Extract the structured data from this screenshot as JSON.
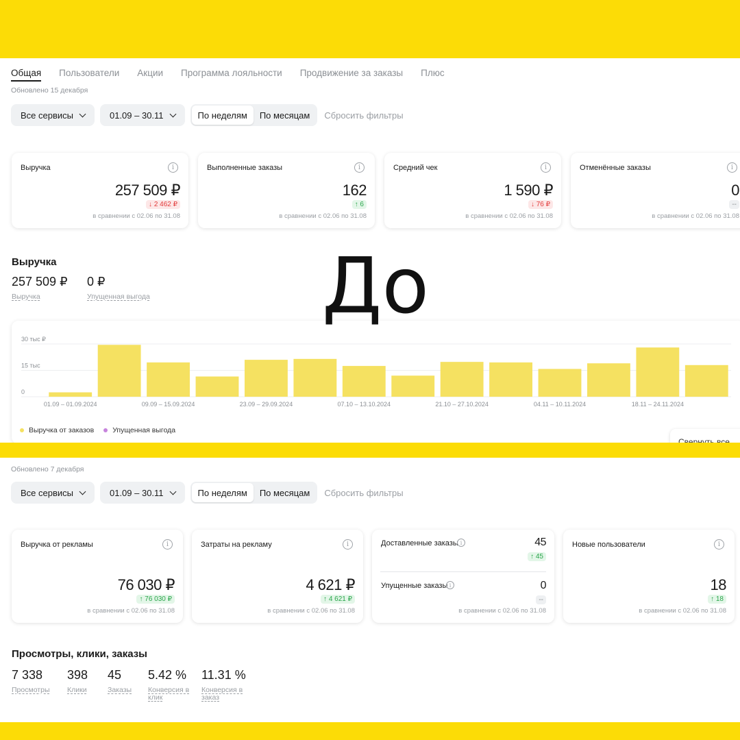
{
  "colors": {
    "brand_yellow": "#fcdc06",
    "bar_yellow": "#f5e161",
    "lost_purple": "#c784dd",
    "up_green": "#2aa54b",
    "down_red": "#e23b3b"
  },
  "overlay_label": "До",
  "top": {
    "tabs": [
      "Общая",
      "Пользователи",
      "Акции",
      "Программа лояльности",
      "Продвижение за заказы",
      "Плюс"
    ],
    "updated": "Обновлено 15 декабря",
    "filters": {
      "services": "Все сервисы",
      "period": "01.09 – 30.11",
      "by_week": "По неделям",
      "by_month": "По месяцам",
      "reset": "Сбросить фильтры"
    },
    "cards": [
      {
        "title": "Выручка",
        "value": "257 509 ₽",
        "delta": "↓ 2 462 ₽",
        "trend": "down",
        "compare": "в сравнении с 02.06 по 31.08"
      },
      {
        "title": "Выполненные заказы",
        "value": "162",
        "delta": "↑ 6",
        "trend": "up",
        "compare": "в сравнении с 02.06 по 31.08"
      },
      {
        "title": "Средний чек",
        "value": "1 590 ₽",
        "delta": "↓ 76 ₽",
        "trend": "down",
        "compare": "в сравнении с 02.06 по 31.08"
      },
      {
        "title": "Отменённые заказы",
        "value": "0",
        "delta": "--",
        "trend": "neutral",
        "compare": "в сравнении с 02.06 по 31.08"
      }
    ],
    "revenue_section": {
      "heading": "Выручка",
      "metrics": [
        {
          "value": "257 509 ₽",
          "label": "Выручка"
        },
        {
          "value": "0 ₽",
          "label": "Упущенная выгода"
        }
      ],
      "legend": [
        "Выручка от заказов",
        "Упущенная выгода"
      ],
      "collapse_button": "Свернуть все"
    }
  },
  "chart_data": {
    "type": "bar",
    "ylim": [
      0,
      30000
    ],
    "y_ticks": [
      "0",
      "15 тыс",
      "30 тыс ₽"
    ],
    "categories": [
      "01.09 – 01.09.2024",
      "02.09 – 08.09.2024",
      "09.09 – 15.09.2024",
      "16.09 – 22.09.2024",
      "23.09 – 29.09.2024",
      "30.09 – 06.10.2024",
      "07.10 – 13.10.2024",
      "14.10 – 20.10.2024",
      "21.10 – 27.10.2024",
      "28.10 – 03.11.2024",
      "04.11 – 10.11.2024",
      "11.11 – 17.11.2024",
      "18.11 – 24.11.2024",
      "25.11 – 30.11.2024"
    ],
    "x_labels_shown": [
      "01.09 – 01.09.2024",
      "09.09 – 15.09.2024",
      "23.09 – 29.09.2024",
      "07.10 – 13.10.2024",
      "21.10 – 27.10.2024",
      "04.11 – 10.11.2024",
      "18.11 – 24.11.2024"
    ],
    "series": [
      {
        "name": "Выручка от заказов",
        "values": [
          2500,
          29500,
          19500,
          11500,
          21000,
          21500,
          17500,
          12000,
          19800,
          19500,
          15800,
          19000,
          28000,
          18000
        ]
      },
      {
        "name": "Упущенная выгода",
        "values": [
          0,
          0,
          0,
          0,
          0,
          0,
          0,
          0,
          0,
          0,
          0,
          0,
          0,
          0
        ]
      }
    ],
    "legend_position": "bottom-left",
    "grid": true
  },
  "bottom": {
    "updated": "Обновлено 7 декабря",
    "filters": {
      "services": "Все сервисы",
      "period": "01.09 – 30.11",
      "by_week": "По неделям",
      "by_month": "По месяцам",
      "reset": "Сбросить фильтры"
    },
    "cards": [
      {
        "title": "Выручка от рекламы",
        "value": "76 030 ₽",
        "delta": "↑ 76 030 ₽",
        "trend": "up",
        "compare": "в сравнении с 02.06 по 31.08"
      },
      {
        "title": "Затраты на рекламу",
        "value": "4 621 ₽",
        "delta": "↑ 4 621 ₽",
        "trend": "up",
        "compare": "в сравнении с 02.06 по 31.08"
      },
      {
        "title": "Новые пользователи",
        "value": "18",
        "delta": "↑ 18",
        "trend": "up",
        "compare": "в сравнении с 02.06 по 31.08"
      }
    ],
    "split_card": {
      "top_title": "Доставленные заказы",
      "top_value": "45",
      "top_delta": "↑ 45",
      "bottom_title": "Упущенные заказы",
      "bottom_value": "0",
      "bottom_delta": "--",
      "compare": "в сравнении с 02.06 по 31.08"
    },
    "funnel": {
      "heading": "Просмотры, клики, заказы",
      "metrics": [
        {
          "value": "7 338",
          "label": "Просмотры"
        },
        {
          "value": "398",
          "label": "Клики"
        },
        {
          "value": "45",
          "label": "Заказы"
        },
        {
          "value": "5.42 %",
          "label": "Конверсия в клик"
        },
        {
          "value": "11.31 %",
          "label": "Конверсия в заказ"
        }
      ]
    }
  }
}
